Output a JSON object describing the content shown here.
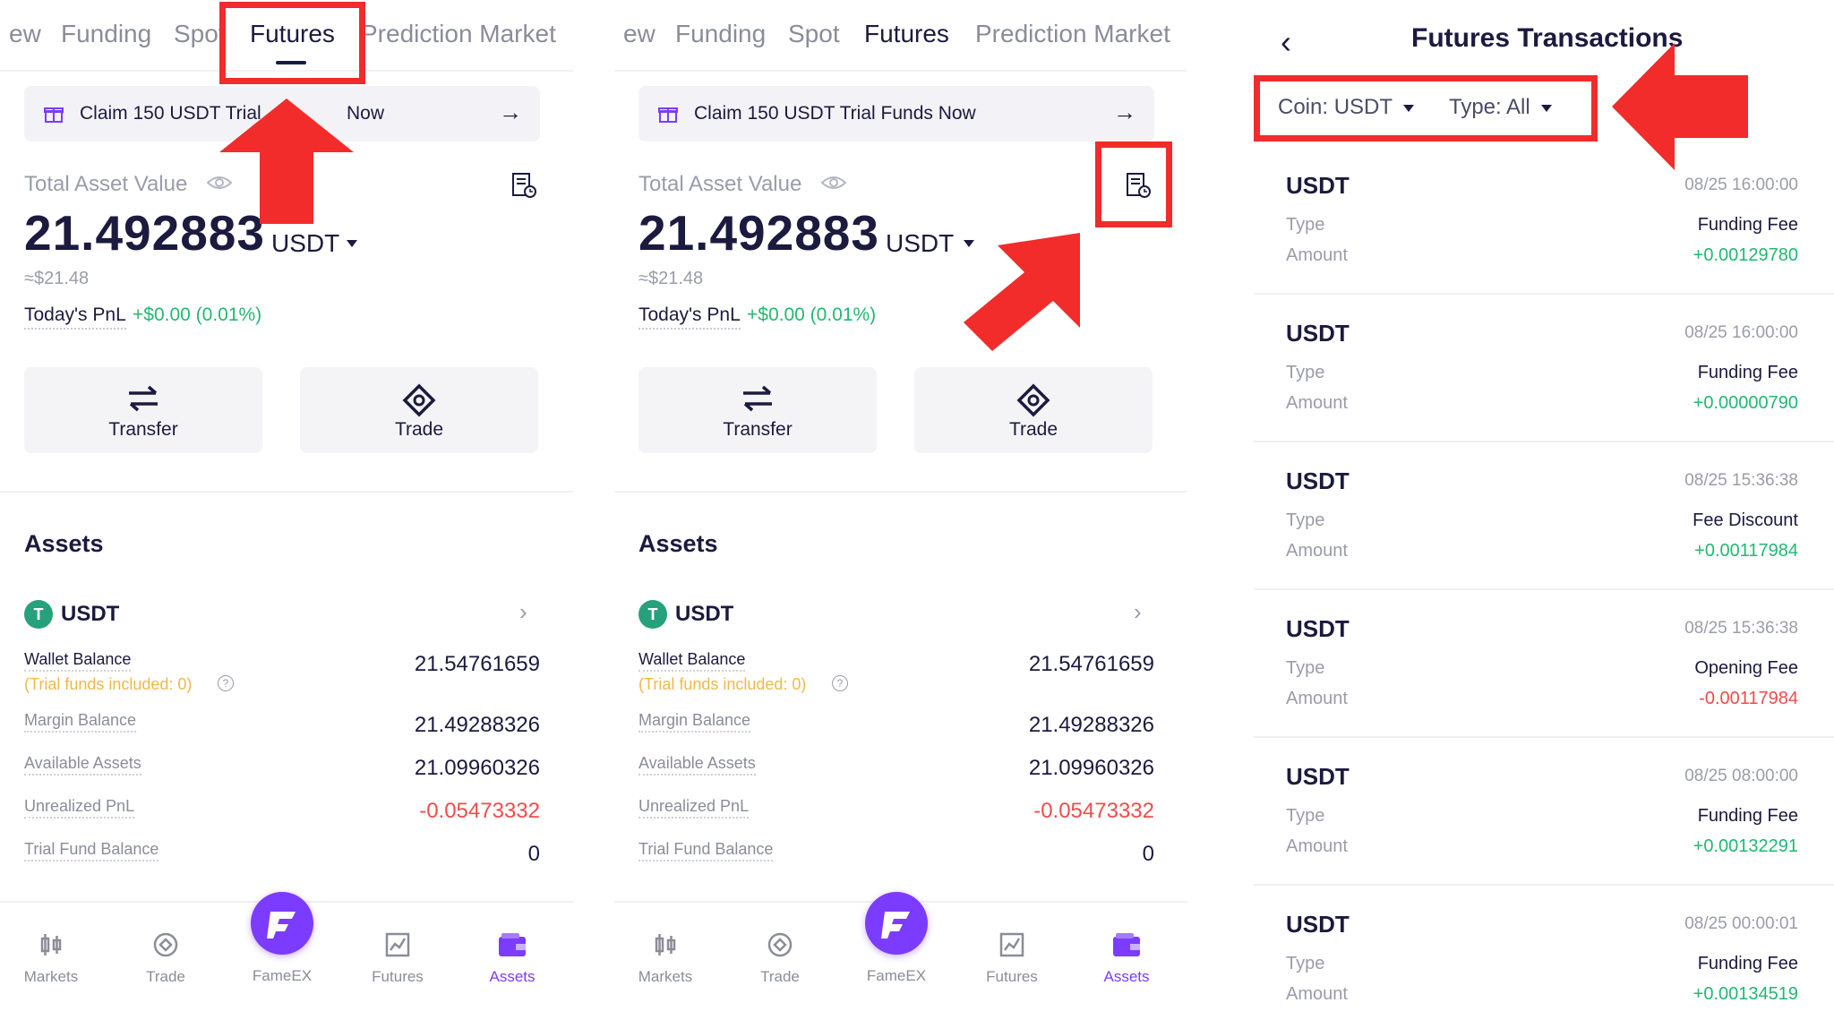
{
  "tabs": [
    {
      "label": "ew",
      "active": false
    },
    {
      "label": "Funding",
      "active": false
    },
    {
      "label": "Spot",
      "active": false
    },
    {
      "label": "Futures",
      "active": true
    },
    {
      "label": "Prediction Market",
      "active": false
    }
  ],
  "banner": {
    "text": "Claim 150 USDT Trial Funds Now",
    "text_partial_left": "Claim 150 USDT Trial",
    "text_partial_right": "Now",
    "arrow": "→"
  },
  "summary": {
    "total_label": "Total Asset Value",
    "value": "21.492883",
    "unit": "USDT",
    "usd": "≈$21.48",
    "pnl_label": "Today's PnL",
    "pnl_value": "+$0.00 (0.01%)"
  },
  "actions": {
    "transfer": "Transfer",
    "trade": "Trade"
  },
  "assets": {
    "title": "Assets",
    "coin": "USDT",
    "coin_logo": "T",
    "rows": {
      "wallet_label": "Wallet Balance",
      "wallet_value": "21.54761659",
      "trial_note": "(Trial funds included: 0)",
      "qmark": "?",
      "margin_label": "Margin Balance",
      "margin_value": "21.49288326",
      "available_label": "Available Assets",
      "available_value": "21.09960326",
      "unrealized_label": "Unrealized PnL",
      "unrealized_value": "-0.05473332",
      "trial_label": "Trial Fund Balance",
      "trial_value": "0"
    }
  },
  "nav": {
    "markets": "Markets",
    "trade": "Trade",
    "fameex": "FameEX",
    "futures": "Futures",
    "assets": "Assets"
  },
  "transactions": {
    "back": "‹",
    "title": "Futures Transactions",
    "coin_filter": "Coin: USDT",
    "type_filter": "Type: All",
    "type_label": "Type",
    "amount_label": "Amount",
    "items": [
      {
        "coin": "USDT",
        "time": "08/25 16:00:00",
        "type": "Funding Fee",
        "amount": "+0.00129780",
        "negative": false
      },
      {
        "coin": "USDT",
        "time": "08/25 16:00:00",
        "type": "Funding Fee",
        "amount": "+0.00000790",
        "negative": false
      },
      {
        "coin": "USDT",
        "time": "08/25 15:36:38",
        "type": "Fee Discount",
        "amount": "+0.00117984",
        "negative": false
      },
      {
        "coin": "USDT",
        "time": "08/25 15:36:38",
        "type": "Opening Fee",
        "amount": "-0.00117984",
        "negative": true
      },
      {
        "coin": "USDT",
        "time": "08/25 08:00:00",
        "type": "Funding Fee",
        "amount": "+0.00132291",
        "negative": false
      },
      {
        "coin": "USDT",
        "time": "08/25 00:00:01",
        "type": "Funding Fee",
        "amount": "+0.00134519",
        "negative": false
      }
    ]
  },
  "colors": {
    "accent": "#7b3cff",
    "positive": "#22b871",
    "negative": "#f24b4b",
    "annotation": "#f22b2b",
    "text": "#1b1a3f"
  },
  "icons": [
    "gift-icon",
    "eye-icon",
    "bill-history-icon",
    "transfer-icon",
    "trade-icon",
    "markets-icon",
    "fameex-logo-icon",
    "futures-icon",
    "wallet-icon",
    "chevron-right-icon",
    "back-icon"
  ]
}
